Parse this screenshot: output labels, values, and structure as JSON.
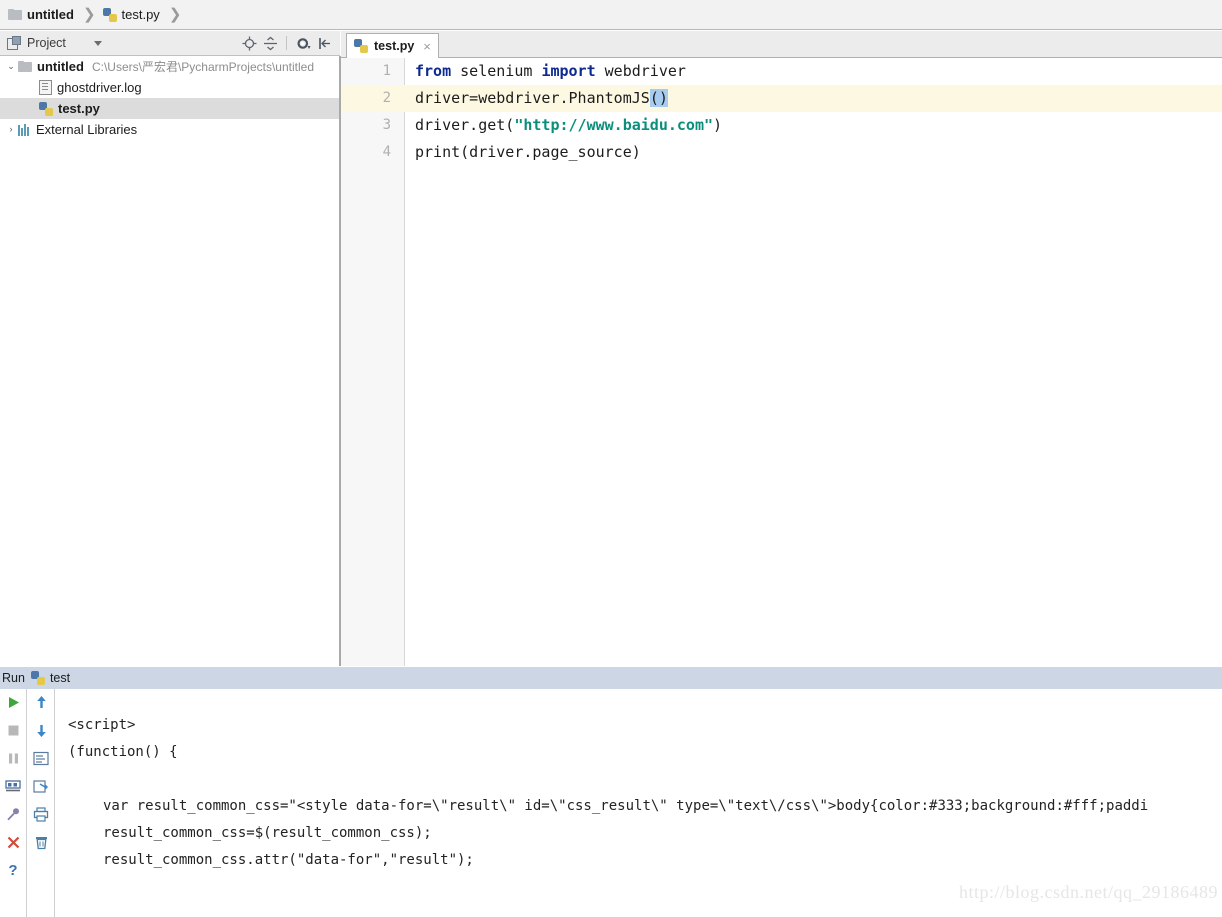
{
  "breadcrumb": {
    "items": [
      {
        "label": "untitled",
        "icon": "folder-icon",
        "bold": true
      },
      {
        "label": "test.py",
        "icon": "python-file-icon",
        "bold": false
      }
    ],
    "separator": "❯"
  },
  "project_panel": {
    "title": "Project",
    "caret": "dropdown-caret-icon",
    "toolbar_icons": [
      "locate-target-icon",
      "collapse-all-icon",
      "settings-gear-icon",
      "hide-panel-icon"
    ],
    "tree": [
      {
        "arrow": "⌄",
        "icon": "folder-icon",
        "label": "untitled",
        "bold": true,
        "path": "C:\\Users\\严宏君\\PycharmProjects\\untitled",
        "selected": false,
        "indent": 0
      },
      {
        "arrow": "",
        "icon": "log-file-icon",
        "label": "ghostdriver.log",
        "bold": false,
        "path": "",
        "selected": false,
        "indent": 1
      },
      {
        "arrow": "",
        "icon": "python-file-icon",
        "label": "test.py",
        "bold": true,
        "path": "",
        "selected": true,
        "indent": 1
      },
      {
        "arrow": "›",
        "icon": "external-libraries-icon",
        "label": "External Libraries",
        "bold": false,
        "path": "",
        "selected": false,
        "indent": 0
      }
    ]
  },
  "editor": {
    "tabs": [
      {
        "label": "test.py",
        "icon": "python-file-icon",
        "close": "×",
        "active": true
      }
    ],
    "lines": [
      {
        "number": "1",
        "current": false,
        "tokens": [
          {
            "text": "from",
            "type": "keyword"
          },
          {
            "text": " selenium ",
            "type": "plain"
          },
          {
            "text": "import",
            "type": "keyword"
          },
          {
            "text": " webdriver",
            "type": "plain"
          }
        ]
      },
      {
        "number": "2",
        "current": true,
        "tokens": [
          {
            "text": "driver=webdriver.PhantomJS",
            "type": "plain"
          },
          {
            "text": "()",
            "type": "selected"
          }
        ]
      },
      {
        "number": "3",
        "current": false,
        "tokens": [
          {
            "text": "driver.get(",
            "type": "plain"
          },
          {
            "text": "\"http://www.baidu.com\"",
            "type": "string"
          },
          {
            "text": ")",
            "type": "plain"
          }
        ]
      },
      {
        "number": "4",
        "current": false,
        "tokens": [
          {
            "text": "print(driver.page_source)",
            "type": "plain"
          }
        ]
      }
    ]
  },
  "run_panel": {
    "title": "Run",
    "tab": {
      "label": "test",
      "icon": "python-file-icon"
    },
    "toolbar_left": [
      "run-play-icon",
      "stop-icon",
      "pause-icon",
      "console-icon",
      "pin-icon",
      "close-x-icon",
      "help-question-icon"
    ],
    "toolbar_right": [
      "arrow-up-icon",
      "arrow-down-icon",
      "soft-wrap-icon",
      "export-icon",
      "print-icon",
      "trash-icon"
    ],
    "console_lines": [
      {
        "text": "<script>",
        "indent": false
      },
      {
        "text": "(function() {",
        "indent": false
      },
      {
        "text": "",
        "indent": false
      },
      {
        "text": "var result_common_css=\"<style data-for=\\\"result\\\" id=\\\"css_result\\\" type=\\\"text\\/css\\\">body{color:#333;background:#fff;paddi",
        "indent": true
      },
      {
        "text": "result_common_css=$(result_common_css);",
        "indent": true
      },
      {
        "text": "result_common_css.attr(\"data-for\",\"result\");",
        "indent": true
      }
    ]
  },
  "watermark": "http://blog.csdn.net/qq_29186489",
  "colors": {
    "run_header_bg": "#ccd6e5",
    "current_line_bg": "#fdf8e2",
    "selection_bg": "#a8cbf0",
    "keyword": "#0c2a8f",
    "string": "#0b8f7c",
    "tree_selected_bg": "#dcdcdc"
  }
}
